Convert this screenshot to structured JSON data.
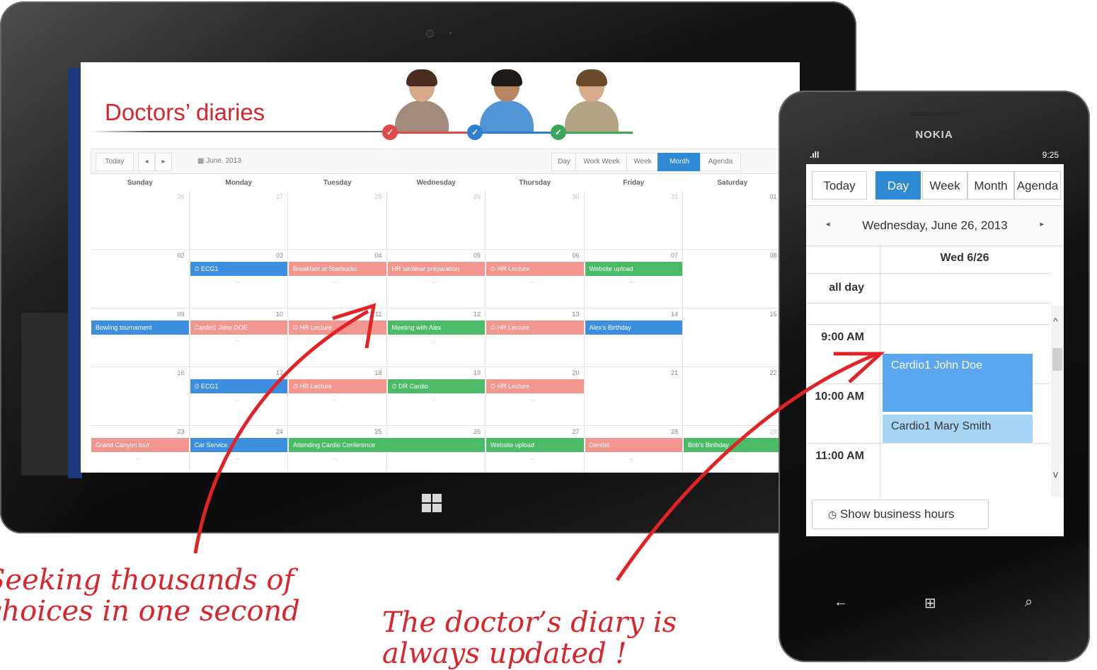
{
  "tablet": {
    "app_title": "Doctors’ diaries",
    "toolbar": {
      "today": "Today",
      "prev": "◂",
      "next": "▸",
      "calendar_icon": "calendar-icon",
      "date_label": "June, 2013",
      "views": [
        "Day",
        "Work Week",
        "Week",
        "Month",
        "Agenda"
      ],
      "selected_view": "Month"
    },
    "weekdays": [
      "Sunday",
      "Monday",
      "Tuesday",
      "Wednesday",
      "Thursday",
      "Friday",
      "Saturday"
    ],
    "weeks": [
      [
        "26",
        "27",
        "28",
        "29",
        "30",
        "31",
        "01"
      ],
      [
        "02",
        "03",
        "04",
        "05",
        "06",
        "07",
        "08"
      ],
      [
        "09",
        "10",
        "11",
        "12",
        "13",
        "14",
        "15"
      ],
      [
        "16",
        "17",
        "18",
        "19",
        "20",
        "21",
        "22"
      ],
      [
        "23",
        "24",
        "25",
        "26",
        "27",
        "28",
        "29"
      ]
    ],
    "events": [
      {
        "week": 1,
        "day": 1,
        "span": 1,
        "label": "⏱ ECG1",
        "color": "blue"
      },
      {
        "week": 1,
        "day": 2,
        "span": 1,
        "label": "Breakfast at Starbucks",
        "color": "red"
      },
      {
        "week": 1,
        "day": 3,
        "span": 1,
        "label": "HR seminar preparation",
        "color": "red"
      },
      {
        "week": 1,
        "day": 4,
        "span": 1,
        "label": "⏱ HR Lecture",
        "color": "red"
      },
      {
        "week": 1,
        "day": 5,
        "span": 1,
        "label": "Website upload",
        "color": "green"
      },
      {
        "week": 2,
        "day": 0,
        "span": 1,
        "label": "Bowling tournament",
        "color": "blue"
      },
      {
        "week": 2,
        "day": 1,
        "span": 1,
        "label": "Cardio1 John DOE",
        "color": "red"
      },
      {
        "week": 2,
        "day": 2,
        "span": 1,
        "label": "⏱ HR Lecture",
        "color": "red"
      },
      {
        "week": 2,
        "day": 3,
        "span": 1,
        "label": "Meeting with Alex",
        "color": "green"
      },
      {
        "week": 2,
        "day": 4,
        "span": 1,
        "label": "⏱ HR Lecture",
        "color": "red"
      },
      {
        "week": 2,
        "day": 5,
        "span": 1,
        "label": "Alex's Birthday",
        "color": "blue"
      },
      {
        "week": 3,
        "day": 1,
        "span": 1,
        "label": "⏱ ECG1",
        "color": "blue"
      },
      {
        "week": 3,
        "day": 2,
        "span": 1,
        "label": "⏱ HR Lecture",
        "color": "red"
      },
      {
        "week": 3,
        "day": 3,
        "span": 1,
        "label": "⏱ DR Cardio",
        "color": "green"
      },
      {
        "week": 3,
        "day": 4,
        "span": 1,
        "label": "⏱ HR Lecture",
        "color": "red"
      },
      {
        "week": 4,
        "day": 0,
        "span": 1,
        "label": "Grand Canyon tour",
        "color": "red"
      },
      {
        "week": 4,
        "day": 1,
        "span": 1,
        "label": "Car Service",
        "color": "blue"
      },
      {
        "week": 4,
        "day": 2,
        "span": 2,
        "label": "Attending Cardio Conference",
        "color": "green"
      },
      {
        "week": 4,
        "day": 4,
        "span": 1,
        "label": "Website upload",
        "color": "green"
      },
      {
        "week": 4,
        "day": 5,
        "span": 1,
        "label": "Dentist",
        "color": "red"
      },
      {
        "week": 4,
        "day": 6,
        "span": 1,
        "label": "Bob's Birthday",
        "color": "green"
      }
    ],
    "more_label": "..."
  },
  "phone": {
    "brand": "NOKIA",
    "signal": ".ıll",
    "time": "9:25",
    "views": [
      "Today",
      "Day",
      "Week",
      "Month",
      "Agenda"
    ],
    "selected_view": "Day",
    "prev": "◂",
    "next": "▸",
    "date_label": "Wednesday, June 26, 2013",
    "column_header": "Wed 6/26",
    "all_day": "all day",
    "times": [
      "9:00 AM",
      "10:00 AM",
      "11:00 AM"
    ],
    "events": [
      "Cardio1 John Doe",
      "Cardio1 Mary Smith"
    ],
    "business_hours": "Show business hours",
    "keys": [
      "←",
      "⊞",
      "⌕"
    ]
  },
  "annotations": {
    "left": "Seeking thousands of choices in one second",
    "right": "The doctor’s diary is always updated !"
  },
  "colors": {
    "accent_red": "#d9252b",
    "blue": "#3b8fde",
    "red": "#f2978f",
    "green": "#4cbb68"
  }
}
